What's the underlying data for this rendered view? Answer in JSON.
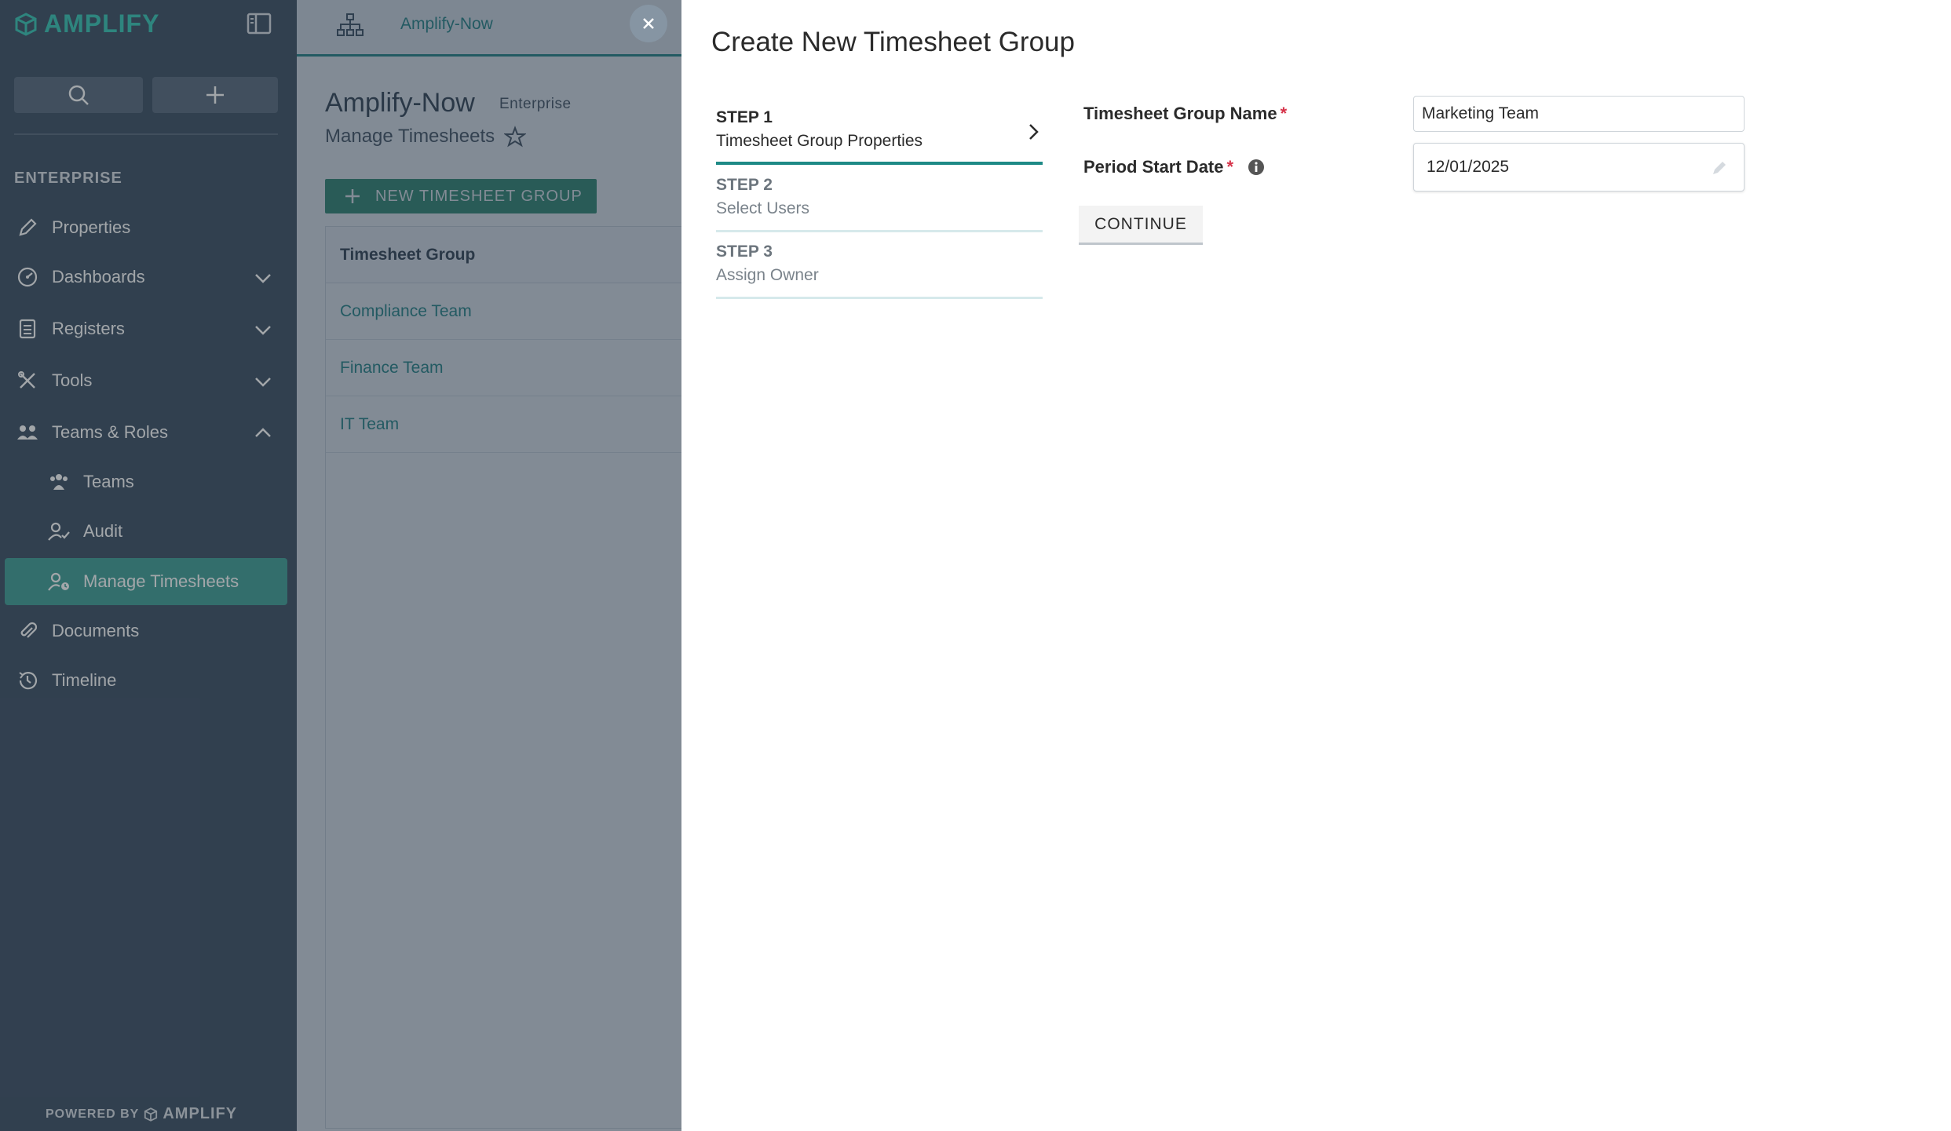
{
  "app": {
    "logo_text": "AMPLIFY",
    "brand_color": "#43bfb5",
    "accent_color": "#1e8a86"
  },
  "sidebar": {
    "section_label": "ENTERPRISE",
    "items": [
      {
        "label": "Properties",
        "icon": "pencil-icon"
      },
      {
        "label": "Dashboards",
        "icon": "gauge-icon",
        "expandable": true
      },
      {
        "label": "Registers",
        "icon": "register-icon",
        "expandable": true
      },
      {
        "label": "Tools",
        "icon": "tools-icon",
        "expandable": true
      },
      {
        "label": "Teams & Roles",
        "icon": "users-icon",
        "expanded": true
      },
      {
        "label": "Teams",
        "icon": "team-icon",
        "sub": true
      },
      {
        "label": "Audit",
        "icon": "user-check-icon",
        "sub": true
      },
      {
        "label": "Manage Timesheets",
        "icon": "user-clock-icon",
        "sub": true,
        "active": true
      },
      {
        "label": "Documents",
        "icon": "paperclip-icon"
      },
      {
        "label": "Timeline",
        "icon": "history-icon"
      }
    ],
    "powered_by": "POWERED BY",
    "powered_brand": "AMPLIFY"
  },
  "main": {
    "breadcrumb": "Amplify-Now",
    "title": "Amplify-Now",
    "title_badge": "Enterprise",
    "subtitle": "Manage Timesheets",
    "new_button": "NEW TIMESHEET GROUP",
    "table": {
      "header": "Timesheet Group",
      "rows": [
        "Compliance Team",
        "Finance Team",
        "IT Team"
      ]
    }
  },
  "modal": {
    "title": "Create New Timesheet Group",
    "steps": [
      {
        "num": "STEP 1",
        "name": "Timesheet Group Properties",
        "active": true
      },
      {
        "num": "STEP 2",
        "name": "Select Users",
        "active": false
      },
      {
        "num": "STEP 3",
        "name": "Assign Owner",
        "active": false
      }
    ],
    "fields": {
      "group_name_label": "Timesheet Group Name",
      "group_name_value": "Marketing Team",
      "start_date_label": "Period Start Date",
      "start_date_value": "12/01/2025",
      "required_mark": "*"
    },
    "continue_label": "CONTINUE"
  }
}
